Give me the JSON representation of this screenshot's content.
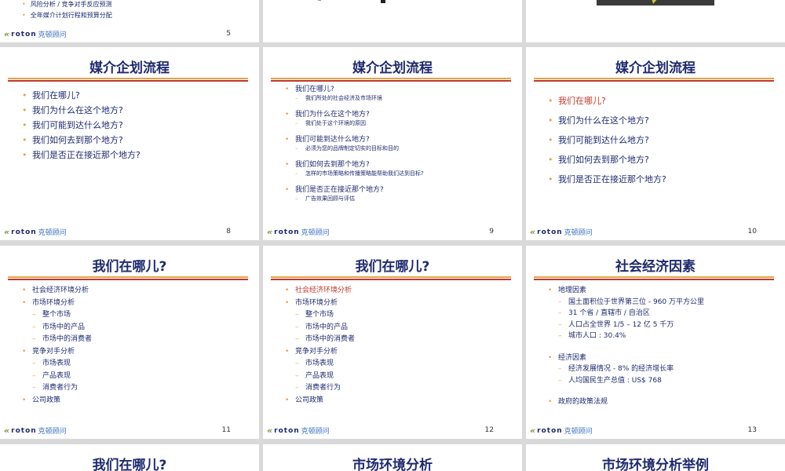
{
  "footer": {
    "logo_glyph": "«",
    "logo_text": "roton",
    "logo_cn": "克顿顾问"
  },
  "slide5": {
    "items": [
      "风险分析 / 竞争对手反应预测",
      "全年媒介计划行程和预算分配"
    ],
    "page": "5"
  },
  "slide8": {
    "title": "媒介企划流程",
    "items": [
      "我们在哪儿?",
      "我们为什么在这个地方?",
      "我们可能到达什么地方?",
      "我们如何去到那个地方?",
      "我们是否正在接近那个地方?"
    ],
    "page": "8"
  },
  "slide9": {
    "title": "媒介企划流程",
    "items": [
      {
        "q": "我们在哪儿?",
        "a": "我们所处的社会经济及市场环境"
      },
      {
        "q": "我们为什么在这个地方?",
        "a": "我们处于这个环境的原因"
      },
      {
        "q": "我们可能到达什么地方?",
        "a": "必须为您的品牌制定切实的目标和目的"
      },
      {
        "q": "我们如何去到那个地方?",
        "a": "怎样的市场策略和传播策略能帮助我们达到目标?"
      },
      {
        "q": "我们是否正在接近那个地方?",
        "a": "广告效果回顾与评估"
      }
    ],
    "page": "9"
  },
  "slide10": {
    "title": "媒介企划流程",
    "items": [
      "我们在哪儿?",
      "我们为什么在这个地方?",
      "我们可能到达什么地方?",
      "我们如何去到那个地方?",
      "我们是否正在接近那个地方?"
    ],
    "page": "10"
  },
  "slide11": {
    "title": "我们在哪儿?",
    "l1": "社会经济环境分析",
    "l2": "市场环境分析",
    "l2a": "整个市场",
    "l2b": "市场中的产品",
    "l2c": "市场中的消费者",
    "l3": "竞争对手分析",
    "l3a": "市场表现",
    "l3b": "产品表现",
    "l3c": "消费者行为",
    "l4": "公司政策",
    "page": "11"
  },
  "slide12": {
    "title": "我们在哪儿?",
    "l1": "社会经济环境分析",
    "l2": "市场环境分析",
    "l2a": "整个市场",
    "l2b": "市场中的产品",
    "l2c": "市场中的消费者",
    "l3": "竞争对手分析",
    "l3a": "市场表现",
    "l3b": "产品表现",
    "l3c": "消费者行为",
    "l4": "公司政策",
    "page": "12"
  },
  "slide13": {
    "title": "社会经济因素",
    "g1": "地理因素",
    "g1a": "国土面积位于世界第三位 - 960 万平方公里",
    "g1b": "31 个省 / 直辖市 / 自治区",
    "g1c": "人口占全世界 1/5 – 12 亿 5 千万",
    "g1d": "城市人口 : 30.4%",
    "g2": "经济因素",
    "g2a": "经济发展情况 - 8% 的经济增长率",
    "g2b": "人均国民生产总值 : US$ 768",
    "g3": "政府的政策法规",
    "page": "13"
  },
  "bottom": {
    "t1": "我们在哪儿?",
    "t2": "市场环境分析",
    "t3": "市场环境分析举例"
  },
  "colors": {
    "navy": "#1f2a6e",
    "red": "#c0392b",
    "orange": "#e8a24a"
  }
}
